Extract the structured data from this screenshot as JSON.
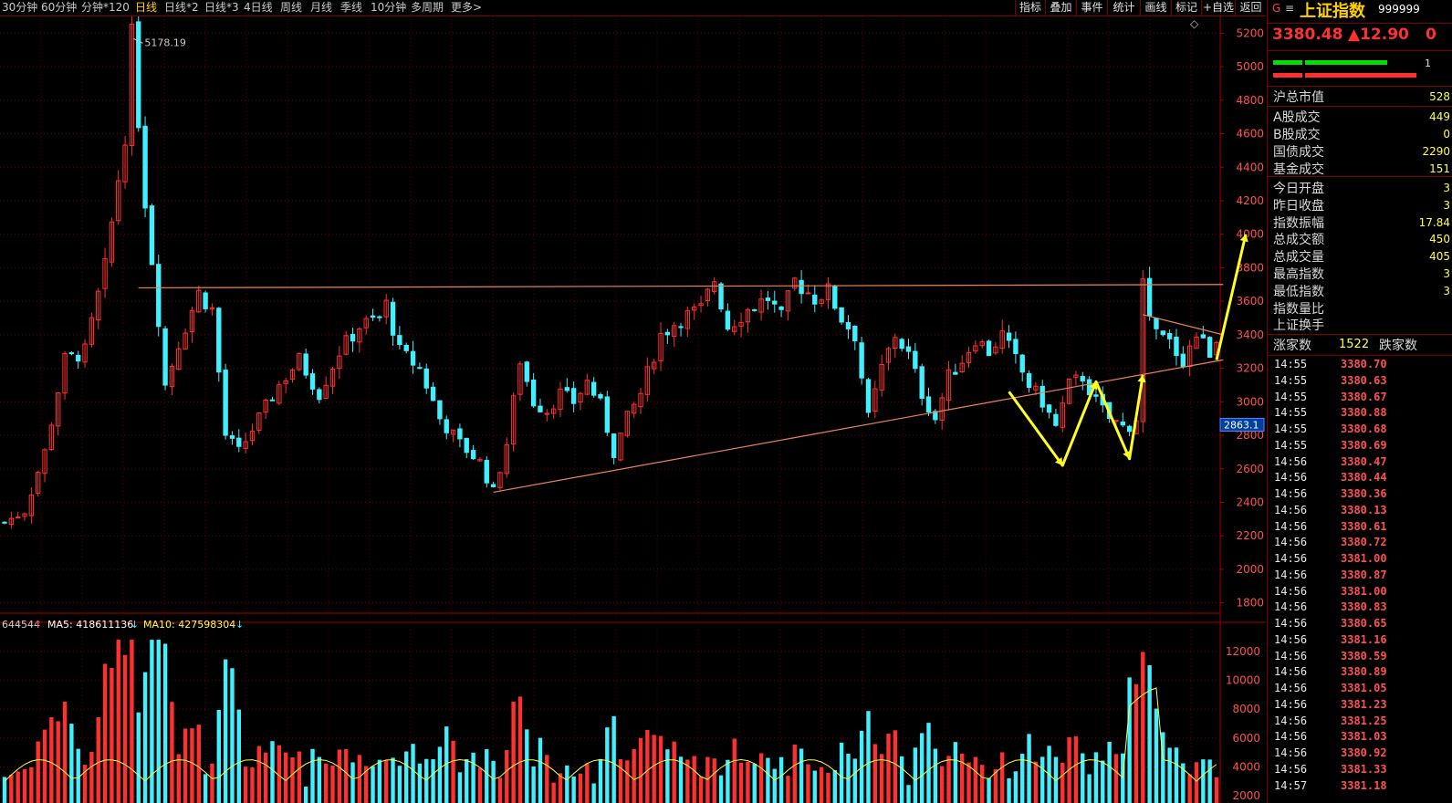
{
  "toolbar": {
    "periods": [
      "30分钟",
      "60分钟",
      "分钟*120",
      "日线",
      "日线*2",
      "日线*3",
      "4日线",
      "周线",
      "月线",
      "季线",
      "10分钟",
      "多周期",
      "更多>"
    ],
    "active_period": "日线",
    "tools": [
      "指标",
      "叠加",
      "事件",
      "统计",
      "画线",
      "标记",
      "+自选",
      "返回"
    ]
  },
  "chart_data": {
    "type": "candlestick",
    "price_axis": {
      "ylim": [
        1700,
        5300
      ],
      "ticks": [
        1800,
        2000,
        2200,
        2400,
        2600,
        2800,
        3000,
        3200,
        3400,
        3600,
        3800,
        4000,
        4200,
        4400,
        4600,
        4800,
        5000,
        5200
      ]
    },
    "peak_label": "5178.19",
    "peak_value": 5178.19,
    "current_price_tag": "2863.1",
    "volume_axis": {
      "ylim": [
        1500,
        13500
      ],
      "ticks": [
        2000,
        4000,
        6000,
        8000,
        10000,
        12000
      ]
    },
    "series_points": [
      [
        0,
        2280
      ],
      [
        3,
        2350
      ],
      [
        6,
        2700
      ],
      [
        9,
        3250
      ],
      [
        12,
        3300
      ],
      [
        15,
        3800
      ],
      [
        18,
        4600
      ],
      [
        19,
        5178
      ],
      [
        21,
        4200
      ],
      [
        23,
        3500
      ],
      [
        24,
        3100
      ],
      [
        26,
        3350
      ],
      [
        29,
        3650
      ],
      [
        31,
        3550
      ],
      [
        33,
        2800
      ],
      [
        35,
        2700
      ],
      [
        38,
        2900
      ],
      [
        41,
        3100
      ],
      [
        44,
        3250
      ],
      [
        47,
        3050
      ],
      [
        50,
        3300
      ],
      [
        53,
        3450
      ],
      [
        56,
        3500
      ],
      [
        57,
        3580
      ],
      [
        59,
        3300
      ],
      [
        62,
        3200
      ],
      [
        65,
        2900
      ],
      [
        68,
        2750
      ],
      [
        71,
        2640
      ],
      [
        73,
        2460
      ],
      [
        75,
        2750
      ],
      [
        77,
        3250
      ],
      [
        79,
        3000
      ],
      [
        81,
        2950
      ],
      [
        83,
        3050
      ],
      [
        85,
        3000
      ],
      [
        87,
        3120
      ],
      [
        89,
        2980
      ],
      [
        91,
        2700
      ],
      [
        93,
        2900
      ],
      [
        95,
        3050
      ],
      [
        98,
        3400
      ],
      [
        101,
        3500
      ],
      [
        104,
        3550
      ],
      [
        106,
        3730
      ],
      [
        108,
        3450
      ],
      [
        111,
        3550
      ],
      [
        114,
        3620
      ],
      [
        116,
        3500
      ],
      [
        118,
        3720
      ],
      [
        121,
        3620
      ],
      [
        123,
        3660
      ],
      [
        125,
        3500
      ],
      [
        127,
        3400
      ],
      [
        129,
        2900
      ],
      [
        131,
        3200
      ],
      [
        133,
        3400
      ],
      [
        135,
        3280
      ],
      [
        137,
        3050
      ],
      [
        139,
        2900
      ],
      [
        141,
        3150
      ],
      [
        143,
        3250
      ],
      [
        145,
        3380
      ],
      [
        147,
        3300
      ],
      [
        149,
        3400
      ],
      [
        151,
        3250
      ],
      [
        153,
        3100
      ],
      [
        155,
        3000
      ],
      [
        157,
        2850
      ],
      [
        159,
        3100
      ],
      [
        161,
        3150
      ],
      [
        163,
        3000
      ],
      [
        165,
        2900
      ],
      [
        167,
        2850
      ],
      [
        169,
        2870
      ],
      [
        170,
        3680
      ],
      [
        172,
        3400
      ],
      [
        174,
        3350
      ],
      [
        176,
        3250
      ],
      [
        178,
        3400
      ],
      [
        180,
        3300
      ],
      [
        181,
        3380
      ]
    ],
    "candles_ref": {
      "count": 182,
      "x0": 5,
      "x1": 1333
    },
    "trendlines": [
      {
        "name": "resistance",
        "color": "#e8845a",
        "from": [
          20,
          3680
        ],
        "to": [
          182,
          3700
        ]
      },
      {
        "name": "support",
        "color": "#e8845a",
        "from": [
          73,
          2460
        ],
        "to": [
          182,
          3250
        ]
      },
      {
        "name": "upper-wedge",
        "color": "#e8845a",
        "from": [
          170,
          3520
        ],
        "to": [
          182,
          3400
        ]
      }
    ],
    "annotation_path": {
      "color": "#ffff20",
      "points": [
        [
          150,
          3060
        ],
        [
          158,
          2620
        ],
        [
          163,
          3120
        ],
        [
          168,
          2660
        ],
        [
          170,
          3160
        ]
      ]
    },
    "annotation_arrow": {
      "color": "#ffff20",
      "from": [
        181,
        3250
      ],
      "to": [
        184,
        4000
      ]
    }
  },
  "volume": {
    "label": "644544",
    "ma5": "MA5: 418611136",
    "ma10": "MA10: 427598304"
  },
  "panel": {
    "code_letter": "G",
    "menu": "≡",
    "title": "上证指数",
    "code": "999999",
    "price": "3380.48",
    "change": "▲12.90",
    "pct": "0",
    "scroll_marker": "1",
    "market_value_label": "沪总市值",
    "market_value": "528",
    "rows1": [
      {
        "label": "A股成交",
        "value": "449"
      },
      {
        "label": "B股成交",
        "value": "0"
      },
      {
        "label": "国债成交",
        "value": "2290"
      },
      {
        "label": "基金成交",
        "value": "151"
      }
    ],
    "rows2": [
      {
        "label": "今日开盘",
        "value": "3"
      },
      {
        "label": "昨日收盘",
        "value": "3"
      },
      {
        "label": "指数振幅",
        "value": "17.84"
      },
      {
        "label": "总成交额",
        "value": "450"
      },
      {
        "label": "总成交量",
        "value": "405"
      },
      {
        "label": "最高指数",
        "value": "3"
      },
      {
        "label": "最低指数",
        "value": "3"
      },
      {
        "label": "指数量比",
        "value": ""
      },
      {
        "label": "上证换手",
        "value": ""
      }
    ],
    "advance_label": "涨家数",
    "advance_value": "1522",
    "decline_label": "跌家数",
    "ticks": [
      {
        "time": "14:55",
        "price": "3380.70"
      },
      {
        "time": "14:55",
        "price": "3380.63"
      },
      {
        "time": "14:55",
        "price": "3380.67"
      },
      {
        "time": "14:55",
        "price": "3380.88"
      },
      {
        "time": "14:55",
        "price": "3380.68"
      },
      {
        "time": "14:55",
        "price": "3380.69"
      },
      {
        "time": "14:56",
        "price": "3380.47"
      },
      {
        "time": "14:56",
        "price": "3380.44"
      },
      {
        "time": "14:56",
        "price": "3380.36"
      },
      {
        "time": "14:56",
        "price": "3380.13"
      },
      {
        "time": "14:56",
        "price": "3380.61"
      },
      {
        "time": "14:56",
        "price": "3380.72"
      },
      {
        "time": "14:56",
        "price": "3381.00"
      },
      {
        "time": "14:56",
        "price": "3380.87"
      },
      {
        "time": "14:56",
        "price": "3381.00"
      },
      {
        "time": "14:56",
        "price": "3380.83"
      },
      {
        "time": "14:56",
        "price": "3380.65"
      },
      {
        "time": "14:56",
        "price": "3381.16"
      },
      {
        "time": "14:56",
        "price": "3380.59"
      },
      {
        "time": "14:56",
        "price": "3380.89"
      },
      {
        "time": "14:56",
        "price": "3381.05"
      },
      {
        "time": "14:56",
        "price": "3381.23"
      },
      {
        "time": "14:56",
        "price": "3381.25"
      },
      {
        "time": "14:56",
        "price": "3381.03"
      },
      {
        "time": "14:56",
        "price": "3380.92"
      },
      {
        "time": "14:56",
        "price": "3381.33"
      },
      {
        "time": "14:57",
        "price": "3381.18"
      }
    ]
  },
  "colors": {
    "up": "#ff3030",
    "down": "#40f0ff",
    "grid": "#7a0000",
    "axis_text": "#ff5050",
    "highlight": "#ffd000"
  }
}
